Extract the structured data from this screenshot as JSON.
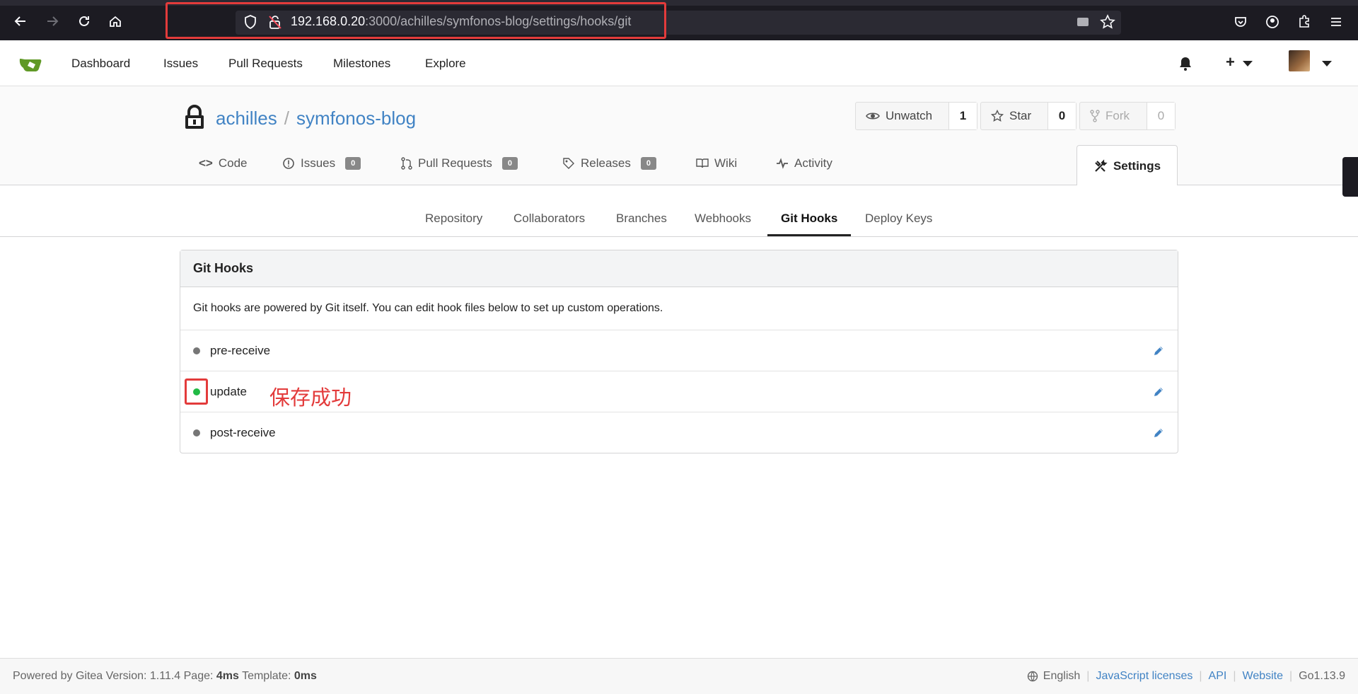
{
  "browser": {
    "url_host": "192.168.0.20",
    "url_path": ":3000/achilles/symfonos-blog/settings/hooks/git"
  },
  "topnav": {
    "items": [
      "Dashboard",
      "Issues",
      "Pull Requests",
      "Milestones",
      "Explore"
    ]
  },
  "repo": {
    "owner": "achilles",
    "separator": "/",
    "name": "symfonos-blog",
    "unwatch_label": "Unwatch",
    "watch_count": "1",
    "star_label": "Star",
    "star_count": "0",
    "fork_label": "Fork",
    "fork_count": "0",
    "tabs": {
      "code": "Code",
      "issues": "Issues",
      "issues_count": "0",
      "pulls": "Pull Requests",
      "pulls_count": "0",
      "releases": "Releases",
      "releases_count": "0",
      "wiki": "Wiki",
      "activity": "Activity",
      "settings": "Settings"
    }
  },
  "settings_tabs": [
    "Repository",
    "Collaborators",
    "Branches",
    "Webhooks",
    "Git Hooks",
    "Deploy Keys"
  ],
  "panel": {
    "title": "Git Hooks",
    "description": "Git hooks are powered by Git itself. You can edit hook files below to set up custom operations.",
    "hooks": [
      {
        "name": "pre-receive",
        "active": false
      },
      {
        "name": "update",
        "active": true
      },
      {
        "name": "post-receive",
        "active": false
      }
    ],
    "annotation": "保存成功"
  },
  "footer": {
    "powered": "Powered by Gitea Version: 1.11.4 Page: ",
    "page_time": "4ms",
    "template_label": " Template: ",
    "template_time": "0ms",
    "language": "English",
    "js_licenses": "JavaScript licenses",
    "api": "API",
    "website": "Website",
    "go_version": "Go1.13.9"
  },
  "colors": {
    "accent": "#4183c4",
    "annotation": "#e33b3b",
    "active_dot": "#21ba45"
  }
}
